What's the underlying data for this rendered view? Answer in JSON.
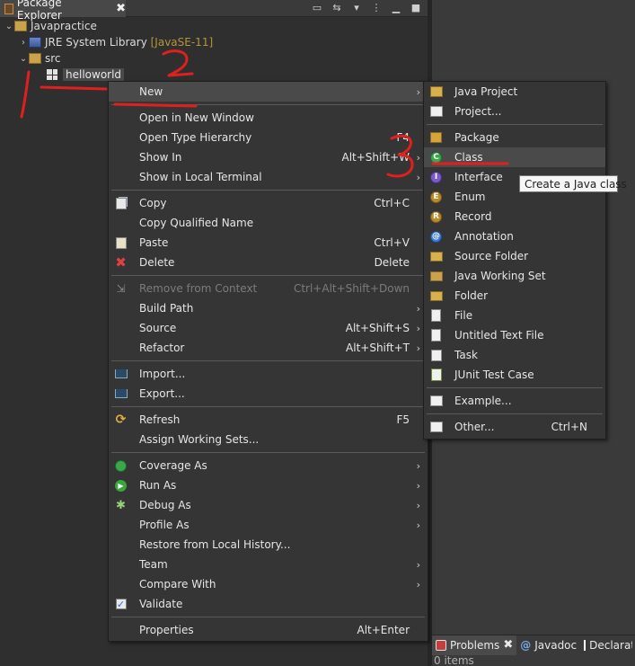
{
  "package_explorer": {
    "tab_label": "Package Explorer",
    "close_glyph": "✖",
    "tree": {
      "project": "Javapractice",
      "library": "JRE System Library",
      "library_version": "[JavaSE-11]",
      "src": "src",
      "package": "helloworld"
    }
  },
  "context_menu": {
    "items": [
      {
        "label": "New",
        "accel": "",
        "submenu": true
      },
      {
        "label": "Open in New Window",
        "accel": ""
      },
      {
        "label": "Open Type Hierarchy",
        "accel": "F4"
      },
      {
        "label": "Show In",
        "accel": "Alt+Shift+W",
        "submenu": true
      },
      {
        "label": "Show in Local Terminal",
        "accel": "",
        "submenu": true
      },
      {
        "label": "Copy",
        "accel": "Ctrl+C",
        "icon": "copy-icon"
      },
      {
        "label": "Copy Qualified Name",
        "accel": ""
      },
      {
        "label": "Paste",
        "accel": "Ctrl+V",
        "icon": "paste-icon"
      },
      {
        "label": "Delete",
        "accel": "Delete",
        "icon": "delete-icon"
      },
      {
        "label": "Remove from Context",
        "accel": "Ctrl+Alt+Shift+Down",
        "disabled": true,
        "icon": "remove-icon"
      },
      {
        "label": "Build Path",
        "accel": "",
        "submenu": true
      },
      {
        "label": "Source",
        "accel": "Alt+Shift+S",
        "submenu": true
      },
      {
        "label": "Refactor",
        "accel": "Alt+Shift+T",
        "submenu": true
      },
      {
        "label": "Import...",
        "accel": "",
        "icon": "import-icon"
      },
      {
        "label": "Export...",
        "accel": "",
        "icon": "export-icon"
      },
      {
        "label": "Refresh",
        "accel": "F5",
        "icon": "refresh-icon"
      },
      {
        "label": "Assign Working Sets...",
        "accel": ""
      },
      {
        "label": "Coverage As",
        "accel": "",
        "submenu": true,
        "icon": "coverage-icon"
      },
      {
        "label": "Run As",
        "accel": "",
        "submenu": true,
        "icon": "run-icon"
      },
      {
        "label": "Debug As",
        "accel": "",
        "submenu": true,
        "icon": "debug-icon"
      },
      {
        "label": "Profile As",
        "accel": "",
        "submenu": true
      },
      {
        "label": "Restore from Local History...",
        "accel": ""
      },
      {
        "label": "Team",
        "accel": "",
        "submenu": true
      },
      {
        "label": "Compare With",
        "accel": "",
        "submenu": true
      },
      {
        "label": "Validate",
        "accel": "",
        "icon": "validate-check-icon"
      },
      {
        "label": "Properties",
        "accel": "Alt+Enter"
      }
    ]
  },
  "new_submenu": {
    "items": [
      {
        "label": "Java Project",
        "accel": ""
      },
      {
        "label": "Project...",
        "accel": ""
      },
      {
        "label": "Package",
        "accel": ""
      },
      {
        "label": "Class",
        "accel": ""
      },
      {
        "label": "Interface",
        "accel": ""
      },
      {
        "label": "Enum",
        "accel": ""
      },
      {
        "label": "Record",
        "accel": ""
      },
      {
        "label": "Annotation",
        "accel": ""
      },
      {
        "label": "Source Folder",
        "accel": ""
      },
      {
        "label": "Java Working Set",
        "accel": ""
      },
      {
        "label": "Folder",
        "accel": ""
      },
      {
        "label": "File",
        "accel": ""
      },
      {
        "label": "Untitled Text File",
        "accel": ""
      },
      {
        "label": "Task",
        "accel": ""
      },
      {
        "label": "JUnit Test Case",
        "accel": ""
      },
      {
        "label": "Example...",
        "accel": ""
      },
      {
        "label": "Other...",
        "accel": "Ctrl+N"
      }
    ]
  },
  "tooltip": "Create a Java class",
  "bottom_panel": {
    "tabs": [
      {
        "label": "Problems"
      },
      {
        "label": "Javadoc"
      },
      {
        "label": "Declaration"
      }
    ],
    "status": "0 items"
  },
  "annotation_color": "#e0201e"
}
